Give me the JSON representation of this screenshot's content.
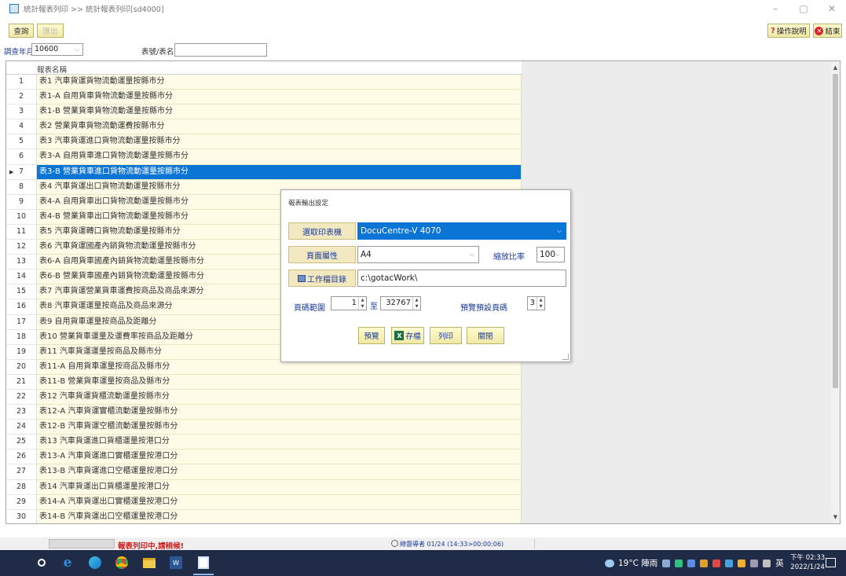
{
  "window": {
    "title": "統計報表列印 >> 統計報表列印[sd4000]",
    "min_label": "–",
    "max_label": "▢",
    "close_label": "✕"
  },
  "toolbar": {
    "query_label": "查詢",
    "export_label": "匯出",
    "help_label": "操作說明",
    "exit_label": "結束"
  },
  "filter": {
    "year_month_label": "調查年月",
    "year_month_value": "10600",
    "table_label": "表號/表名",
    "table_value": ""
  },
  "grid": {
    "column_header": "報表名稱",
    "selected_row": 7,
    "rows": [
      {
        "no": "1",
        "name": "表1 汽車貨運貨物流動運量按縣市分"
      },
      {
        "no": "2",
        "name": "表1-A 自用貨車貨物流動運量按縣市分"
      },
      {
        "no": "3",
        "name": "表1-B 營業貨車貨物流動運量按縣市分"
      },
      {
        "no": "4",
        "name": "表2 營業貨車貨物流動運費按縣市分"
      },
      {
        "no": "5",
        "name": "表3 汽車貨運進口貨物流動運量按縣市分"
      },
      {
        "no": "6",
        "name": "表3-A 自用貨車進口貨物流動運量按縣市分"
      },
      {
        "no": "7",
        "name": "表3-B 營業貨車進口貨物流動運量按縣市分"
      },
      {
        "no": "8",
        "name": "表4 汽車貨運出口貨物流動運量按縣市分"
      },
      {
        "no": "9",
        "name": "表4-A 自用貨車出口貨物流動運量按縣市分"
      },
      {
        "no": "10",
        "name": "表4-B 營業貨車出口貨物流動運量按縣市分"
      },
      {
        "no": "11",
        "name": "表5 汽車貨運轉口貨物流動運量按縣市分"
      },
      {
        "no": "12",
        "name": "表6 汽車貨運國產內銷貨物流動運量按縣市分"
      },
      {
        "no": "13",
        "name": "表6-A 自用貨車國產內銷貨物流動運量按縣市分"
      },
      {
        "no": "14",
        "name": "表6-B 營業貨車國產內銷貨物流動運量按縣市分"
      },
      {
        "no": "15",
        "name": "表7 汽車貨運營業貨車運費按商品及商品來源分"
      },
      {
        "no": "16",
        "name": "表8 汽車貨運運量按商品及商品來源分"
      },
      {
        "no": "17",
        "name": "表9 自用貨車運量按商品及距離分"
      },
      {
        "no": "18",
        "name": "表10 營業貨車運量及運費率按商品及距離分"
      },
      {
        "no": "19",
        "name": "表11 汽車貨運運量按商品及縣市分"
      },
      {
        "no": "20",
        "name": "表11-A 自用貨車運量按商品及縣市分"
      },
      {
        "no": "21",
        "name": "表11-B 營業貨車運量按商品及縣市分"
      },
      {
        "no": "22",
        "name": "表12 汽車貨運貨櫃流動運量按縣市分"
      },
      {
        "no": "23",
        "name": "表12-A 汽車貨運實櫃流動運量按縣市分"
      },
      {
        "no": "24",
        "name": "表12-B 汽車貨運空櫃流動運量按縣市分"
      },
      {
        "no": "25",
        "name": "表13 汽車貨運進口貨櫃運量按港口分"
      },
      {
        "no": "26",
        "name": "表13-A 汽車貨運進口實櫃運量按港口分"
      },
      {
        "no": "27",
        "name": "表13-B 汽車貨運進口空櫃運量按港口分"
      },
      {
        "no": "28",
        "name": "表14 汽車貨運出口貨櫃運量按港口分"
      },
      {
        "no": "29",
        "name": "表14-A 汽車貨運出口實櫃運量按港口分"
      },
      {
        "no": "30",
        "name": "表14-B 汽車貨運出口空櫃運量按港口分"
      }
    ]
  },
  "dialog": {
    "title": "報表輸出設定",
    "printer_label": "選取印表機",
    "printer_value": "DocuCentre-V 4070",
    "page_label": "頁面屬性",
    "page_value": "A4",
    "zoom_label": "縮放比率",
    "zoom_value": "100",
    "dir_label": "工作檔目錄",
    "dir_value": "c:\\gotacWork\\",
    "range_label": "頁碼範圍",
    "range_from": "1",
    "range_to_label": "至",
    "range_to": "32767",
    "preview_pages_label": "預覽預設頁碼",
    "preview_pages_value": "3",
    "preview_button": "預覽",
    "save_button": "存檔",
    "print_button": "列印",
    "close_button": "關閉"
  },
  "status": {
    "message": "報表列印中,請稍候!",
    "info": "總督導者 01/24 (14:33>00:00:06)"
  },
  "taskbar": {
    "weather": "19°C 陣雨",
    "ime": "英",
    "time": "下午 02:33",
    "date": "2022/1/24"
  },
  "colors": {
    "selection": "#0b75d5",
    "row_bg": "#fefbe6",
    "button_bg": "#f0e9a6",
    "label_blue": "#1a3b9b",
    "status_red": "#d01a1a",
    "taskbar": "#1f2b47"
  }
}
